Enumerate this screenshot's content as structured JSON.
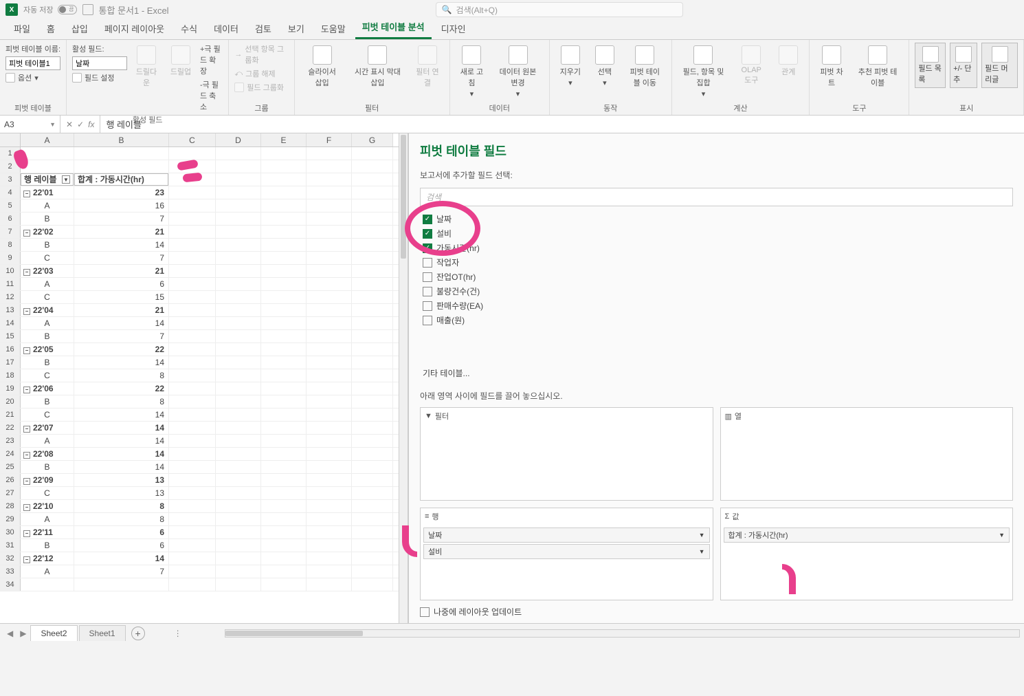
{
  "titlebar": {
    "autosave_label": "자동 저장",
    "autosave_state": "끔",
    "doc_title": "통합 문서1 - Excel",
    "search_placeholder": "검색(Alt+Q)"
  },
  "tabs": {
    "file": "파일",
    "home": "홈",
    "insert": "삽입",
    "layout": "페이지 레이아웃",
    "formulas": "수식",
    "data": "데이터",
    "review": "검토",
    "view": "보기",
    "help": "도움말",
    "pivot_analyze": "피벗 테이블 분석",
    "design": "디자인"
  },
  "ribbon": {
    "pt_name_label": "피벗 테이블 이름:",
    "pt_name_value": "피벗 테이블1",
    "options_label": "옵션",
    "g_pivot": "피벗 테이블",
    "active_field_label": "활성 필드:",
    "active_field_value": "날짜",
    "field_settings": "필드 설정",
    "drilldown": "드릴다운",
    "drillup": "드릴업",
    "expand_field": "+극 필드 확장",
    "collapse_field": "-극 필드 축소",
    "g_active": "활성 필드",
    "group_sel": "선택 항목 그룹화",
    "group_ungroup": "그룹 해제",
    "group_field": "필드 그룹화",
    "g_group": "그룹",
    "slicer": "슬라이서 삽입",
    "timeline": "시간 표시 막대 삽입",
    "filter_conn": "필터 연결",
    "g_filter": "필터",
    "refresh": "새로 고침",
    "change_src": "데이터 원본 변경",
    "g_data": "데이터",
    "clear": "지우기",
    "select": "선택",
    "move": "피벗 테이블 이동",
    "g_action": "동작",
    "calc_field": "필드, 항목 및 집합",
    "olap": "OLAP 도구",
    "relation": "관계",
    "g_calc": "계산",
    "pvt_chart": "피벗 차트",
    "pvt_recommend": "추천 피벗 테이블",
    "g_tools": "도구",
    "field_list": "필드 목록",
    "pm_buttons": "+/- 단추",
    "field_headers": "필드 머리글",
    "g_show": "표시"
  },
  "formula": {
    "cell": "A3",
    "value": "행 레이블"
  },
  "cols": {
    "A": "A",
    "B": "B",
    "C": "C",
    "D": "D",
    "E": "E",
    "F": "F",
    "G": "G"
  },
  "pivot": {
    "row_label": "행 레이블",
    "value_label": "합계 : 가동시간(hr)",
    "rows": [
      {
        "n": 3,
        "type": "hdr"
      },
      {
        "n": 4,
        "type": "grp",
        "a": "22'01",
        "b": "23"
      },
      {
        "n": 5,
        "type": "sub",
        "a": "A",
        "b": "16"
      },
      {
        "n": 6,
        "type": "sub",
        "a": "B",
        "b": "7"
      },
      {
        "n": 7,
        "type": "grp",
        "a": "22'02",
        "b": "21"
      },
      {
        "n": 8,
        "type": "sub",
        "a": "B",
        "b": "14"
      },
      {
        "n": 9,
        "type": "sub",
        "a": "C",
        "b": "7"
      },
      {
        "n": 10,
        "type": "grp",
        "a": "22'03",
        "b": "21"
      },
      {
        "n": 11,
        "type": "sub",
        "a": "A",
        "b": "6"
      },
      {
        "n": 12,
        "type": "sub",
        "a": "C",
        "b": "15"
      },
      {
        "n": 13,
        "type": "grp",
        "a": "22'04",
        "b": "21"
      },
      {
        "n": 14,
        "type": "sub",
        "a": "A",
        "b": "14"
      },
      {
        "n": 15,
        "type": "sub",
        "a": "B",
        "b": "7"
      },
      {
        "n": 16,
        "type": "grp",
        "a": "22'05",
        "b": "22"
      },
      {
        "n": 17,
        "type": "sub",
        "a": "B",
        "b": "14"
      },
      {
        "n": 18,
        "type": "sub",
        "a": "C",
        "b": "8"
      },
      {
        "n": 19,
        "type": "grp",
        "a": "22'06",
        "b": "22"
      },
      {
        "n": 20,
        "type": "sub",
        "a": "B",
        "b": "8"
      },
      {
        "n": 21,
        "type": "sub",
        "a": "C",
        "b": "14"
      },
      {
        "n": 22,
        "type": "grp",
        "a": "22'07",
        "b": "14"
      },
      {
        "n": 23,
        "type": "sub",
        "a": "A",
        "b": "14"
      },
      {
        "n": 24,
        "type": "grp",
        "a": "22'08",
        "b": "14"
      },
      {
        "n": 25,
        "type": "sub",
        "a": "B",
        "b": "14"
      },
      {
        "n": 26,
        "type": "grp",
        "a": "22'09",
        "b": "13"
      },
      {
        "n": 27,
        "type": "sub",
        "a": "C",
        "b": "13"
      },
      {
        "n": 28,
        "type": "grp",
        "a": "22'10",
        "b": "8"
      },
      {
        "n": 29,
        "type": "sub",
        "a": "A",
        "b": "8"
      },
      {
        "n": 30,
        "type": "grp",
        "a": "22'11",
        "b": "6"
      },
      {
        "n": 31,
        "type": "sub",
        "a": "B",
        "b": "6"
      },
      {
        "n": 32,
        "type": "grp",
        "a": "22'12",
        "b": "14"
      },
      {
        "n": 33,
        "type": "sub",
        "a": "A",
        "b": "7"
      },
      {
        "n": 34,
        "type": "sub",
        "a": "",
        "b": ""
      }
    ]
  },
  "pane": {
    "title": "피벗 테이블 필드",
    "choose": "보고서에 추가할 필드 선택:",
    "search": "검색",
    "fields": [
      {
        "label": "날짜",
        "checked": true
      },
      {
        "label": "설비",
        "checked": true
      },
      {
        "label": "가동시간(hr)",
        "checked": true
      },
      {
        "label": "작업자",
        "checked": false
      },
      {
        "label": "잔업OT(hr)",
        "checked": false
      },
      {
        "label": "불량건수(건)",
        "checked": false
      },
      {
        "label": "판매수량(EA)",
        "checked": false
      },
      {
        "label": "매출(원)",
        "checked": false
      }
    ],
    "other_tables": "기타 테이블...",
    "drag_hint": "아래 영역 사이에 필드를 끌어 놓으십시오.",
    "q_filter": "필터",
    "q_cols": "열",
    "q_rows": "행",
    "q_vals": "값",
    "row_pills": [
      "날짜",
      "설비"
    ],
    "val_pills": [
      "합계 : 가동시간(hr)"
    ],
    "defer": "나중에 레이아웃 업데이트"
  },
  "sheets": {
    "s1": "Sheet2",
    "s2": "Sheet1"
  }
}
